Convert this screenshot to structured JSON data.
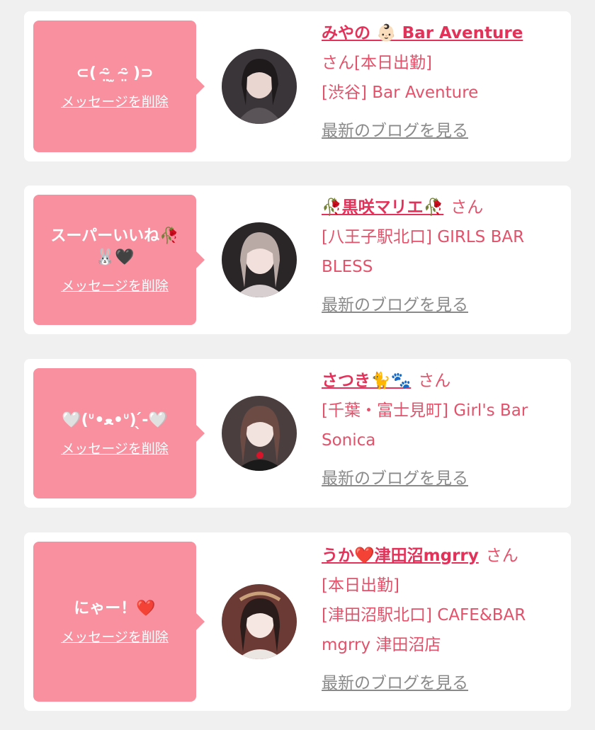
{
  "cards": [
    {
      "message": "⊂( ᵔ̴̤ ̫ ᵔ̴̤ )⊃",
      "delete_label": "メッセージを削除",
      "name": "みやの 👶🏻 Bar Aventure",
      "honorific": "さん[本日出勤]",
      "shop": "[渋谷] Bar Aventure",
      "blog": "最新のブログを見る"
    },
    {
      "message": "スーパーいいね🥀🐰🖤",
      "delete_label": "メッセージを削除",
      "name": "🥀黒咲マリエ🥀",
      "honorific": "さん",
      "shop": "[八王子駅北口] GIRLS BAR BLESS",
      "blog": "最新のブログを見る"
    },
    {
      "message": "🤍(ᐡ•ﻌ•ᐡ) ̖́-🤍",
      "delete_label": "メッセージを削除",
      "name": "さつき🐈🐾",
      "honorific": "さん",
      "shop": "[千葉・富士見町] Girl's Bar Sonica",
      "blog": "最新のブログを見る"
    },
    {
      "message": "にゃー！❤️",
      "delete_label": "メッセージを削除",
      "name": "うか❤️津田沼mgrry",
      "honorific": "さん",
      "shop": "[本日出勤]",
      "shop2": "[津田沼駅北口] CAFE&BAR mgrry 津田沼店",
      "blog": "最新のブログを見る"
    }
  ]
}
